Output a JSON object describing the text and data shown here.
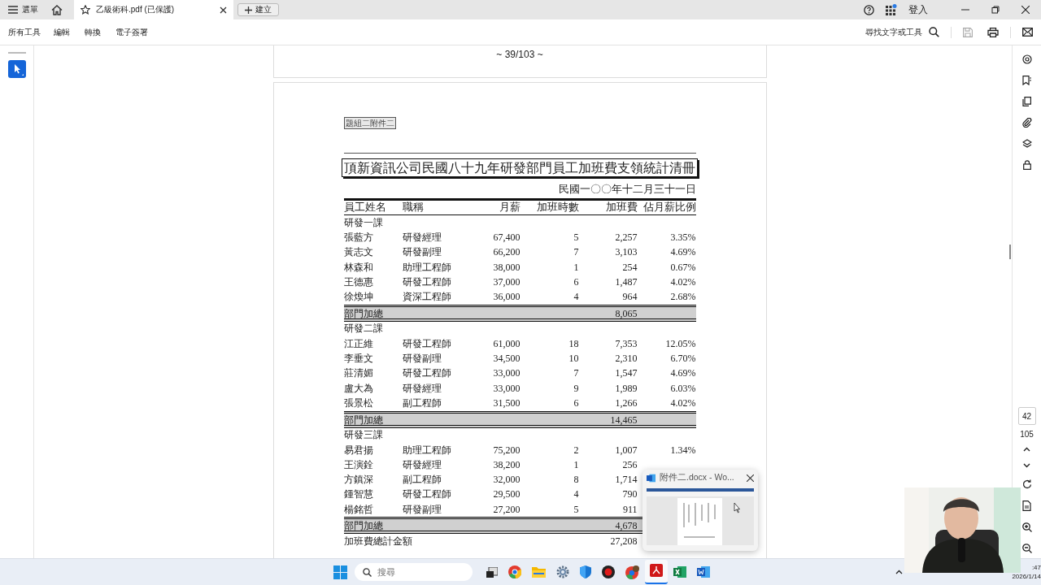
{
  "title_bar": {
    "menu": "選單",
    "tab": {
      "title": "乙級術科.pdf (已保護)"
    },
    "new_tab": "建立",
    "sign_in": "登入"
  },
  "toolbar": {
    "items": [
      "所有工具",
      "編輯",
      "轉換",
      "電子簽署"
    ],
    "search": "尋找文字或工具"
  },
  "document": {
    "previous_page_footer": "~ 39/103 ~",
    "page_label": "題組二附件二",
    "title": "頂新資訊公司民國八十九年研發部門員工加班費支領統計清冊",
    "date": "民國一〇〇年十二月三十一日",
    "columns": [
      "員工姓名",
      "職稱",
      "月薪",
      "加班時數",
      "加班費",
      "佔月薪比例"
    ],
    "sections": [
      {
        "name": "研發一課",
        "subtotal_label": "部門加總",
        "subtotal": "8,065",
        "rows": [
          {
            "name": "張藍方",
            "title": "研發經理",
            "salary": "67,400",
            "hours": "5",
            "fee": "2,257",
            "ratio": "3.35%"
          },
          {
            "name": "黃志文",
            "title": "研發副理",
            "salary": "66,200",
            "hours": "7",
            "fee": "3,103",
            "ratio": "4.69%"
          },
          {
            "name": "林森和",
            "title": "助理工程師",
            "salary": "38,000",
            "hours": "1",
            "fee": "254",
            "ratio": "0.67%"
          },
          {
            "name": "王德惠",
            "title": "研發工程師",
            "salary": "37,000",
            "hours": "6",
            "fee": "1,487",
            "ratio": "4.02%"
          },
          {
            "name": "徐煥坤",
            "title": "資深工程師",
            "salary": "36,000",
            "hours": "4",
            "fee": "964",
            "ratio": "2.68%"
          }
        ]
      },
      {
        "name": "研發二課",
        "subtotal_label": "部門加總",
        "subtotal": "14,465",
        "rows": [
          {
            "name": "江正維",
            "title": "研發工程師",
            "salary": "61,000",
            "hours": "18",
            "fee": "7,353",
            "ratio": "12.05%"
          },
          {
            "name": "李垂文",
            "title": "研發副理",
            "salary": "34,500",
            "hours": "10",
            "fee": "2,310",
            "ratio": "6.70%"
          },
          {
            "name": "莊清媚",
            "title": "研發工程師",
            "salary": "33,000",
            "hours": "7",
            "fee": "1,547",
            "ratio": "4.69%"
          },
          {
            "name": "盧大為",
            "title": "研發經理",
            "salary": "33,000",
            "hours": "9",
            "fee": "1,989",
            "ratio": "6.03%"
          },
          {
            "name": "張景松",
            "title": "副工程師",
            "salary": "31,500",
            "hours": "6",
            "fee": "1,266",
            "ratio": "4.02%"
          }
        ]
      },
      {
        "name": "研發三課",
        "subtotal_label": "部門加總",
        "subtotal": "4,678",
        "rows": [
          {
            "name": "易君揚",
            "title": "助理工程師",
            "salary": "75,200",
            "hours": "2",
            "fee": "1,007",
            "ratio": "1.34%"
          },
          {
            "name": "王演銓",
            "title": "研發經理",
            "salary": "38,200",
            "hours": "1",
            "fee": "256"
          },
          {
            "name": "方鎮深",
            "title": "副工程師",
            "salary": "32,000",
            "hours": "8",
            "fee": "1,714"
          },
          {
            "name": "鍾智慧",
            "title": "研發工程師",
            "salary": "29,500",
            "hours": "4",
            "fee": "790"
          },
          {
            "name": "楊銘哲",
            "title": "研發副理",
            "salary": "27,200",
            "hours": "5",
            "fee": "911"
          }
        ]
      }
    ],
    "total_label": "加班費總計金額",
    "total": "27,208"
  },
  "page_indicator": {
    "current": "42",
    "total": "105"
  },
  "preview_popup": {
    "title": "附件二.docx - Wo..."
  },
  "taskbar": {
    "search_placeholder": "搜尋",
    "time": ":47",
    "date": "2026/1/14"
  }
}
